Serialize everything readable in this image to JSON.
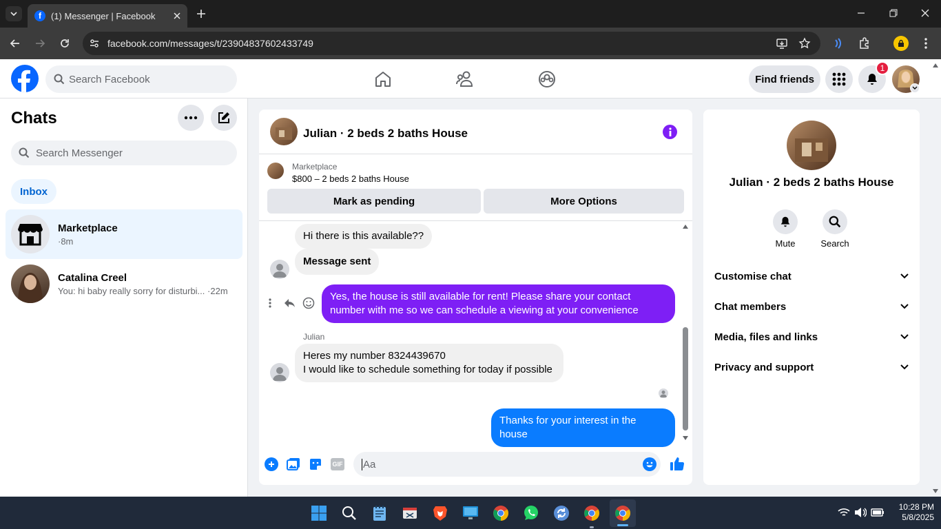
{
  "browser": {
    "tab_title": "(1) Messenger | Facebook",
    "url": "facebook.com/messages/t/23904837602433749"
  },
  "fb": {
    "search_placeholder": "Search Facebook",
    "find_friends": "Find friends",
    "notification_count": "1"
  },
  "chats": {
    "title": "Chats",
    "search_placeholder": "Search Messenger",
    "inbox_label": "Inbox",
    "items": [
      {
        "name": "Marketplace",
        "preview": "·8m"
      },
      {
        "name": "Catalina Creel",
        "preview": "You: hi baby really sorry for disturbi...",
        "time": "·22m"
      }
    ]
  },
  "conversation": {
    "title": "Julian · 2 beds 2 baths House",
    "listing_source": "Marketplace",
    "listing_title": "$800 – 2 beds 2 baths House",
    "mark_pending": "Mark as pending",
    "more_options": "More Options",
    "messages": [
      {
        "text": "Hi there is this available??"
      },
      {
        "text": "Message sent"
      },
      {
        "text": "Yes, the house is still available for rent! Please share your contact number with me so we can schedule a viewing at your convenience"
      },
      {
        "sender": "Julian",
        "line1": "Heres my number 8324439670",
        "line2": "I would like to schedule something for today if possible"
      },
      {
        "text": "Thanks for your interest in the house"
      }
    ],
    "composer_placeholder": "Aa"
  },
  "details": {
    "title": "Julian · 2 beds 2 baths House",
    "mute": "Mute",
    "search": "Search",
    "sections": [
      "Customise chat",
      "Chat members",
      "Media, files and links",
      "Privacy and support"
    ]
  },
  "taskbar": {
    "time": "10:28 PM",
    "date": "5/8/2025"
  },
  "colors": {
    "fb_blue": "#0866ff",
    "outgoing_bubble": "#0a7cff",
    "theme_purple": "#7e1ff5"
  }
}
